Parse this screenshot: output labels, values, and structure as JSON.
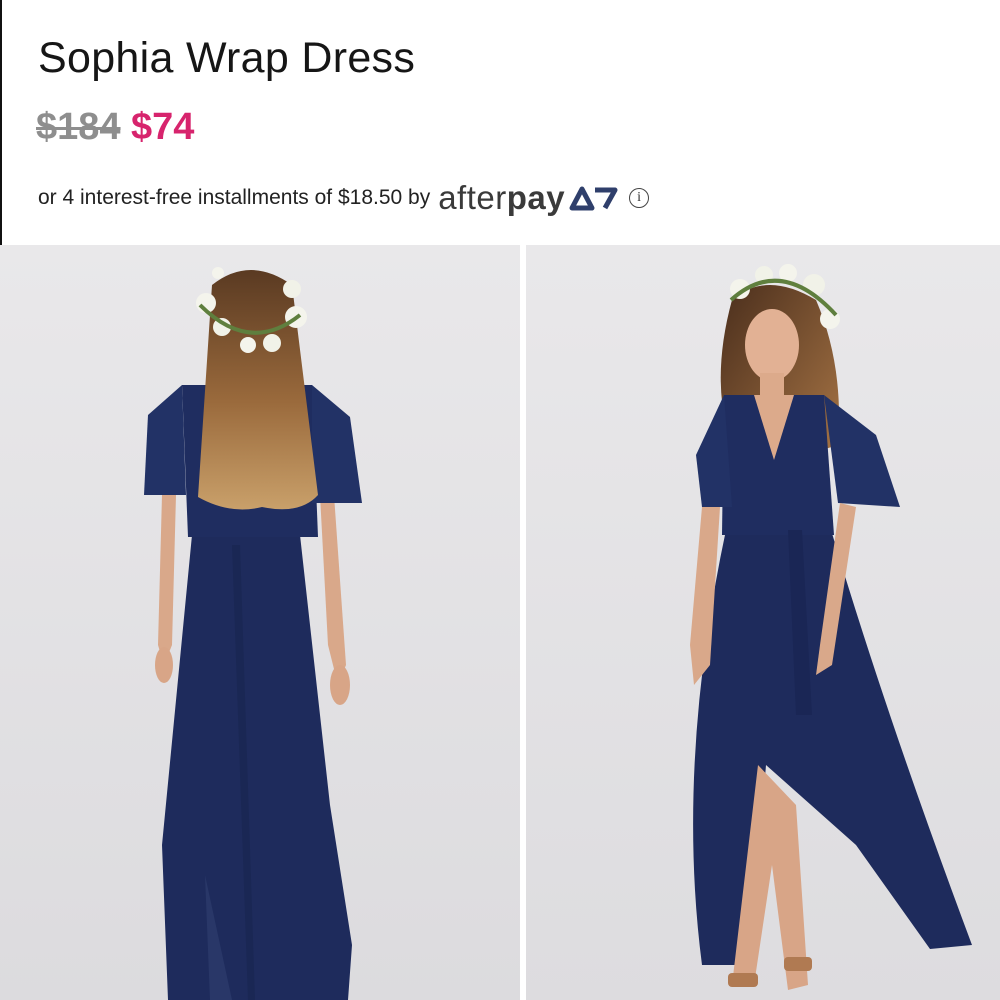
{
  "product": {
    "title": "Sophia Wrap Dress",
    "price_original": "$184",
    "price_sale": "$74",
    "sale_color": "#d7246d",
    "dress_color": "#1e2b5c"
  },
  "afterpay": {
    "text": "or 4 interest-free installments of $18.50 by",
    "logo_word_1": "after",
    "logo_word_2": "pay",
    "info_glyph": "i",
    "info_icon": "info-icon"
  },
  "gallery": {
    "images": [
      {
        "view": "back"
      },
      {
        "view": "front"
      }
    ]
  }
}
